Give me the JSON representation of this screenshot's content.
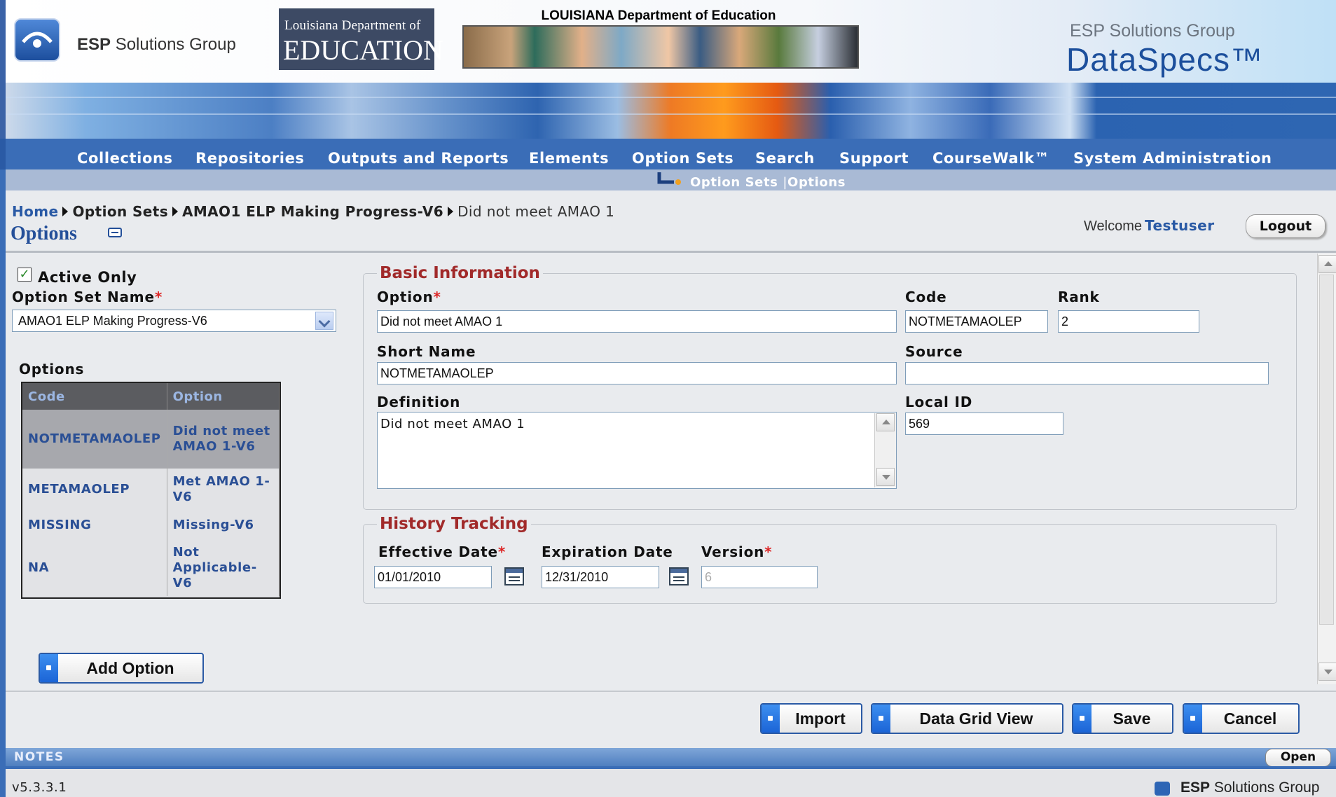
{
  "header": {
    "esp_name_bold": "ESP",
    "esp_name_rest": " Solutions Group",
    "lde_line1": "Louisiana Department of",
    "lde_line2": "EDUCATION",
    "lde_banner_title": "LOUISIANA Department of Education",
    "dataspecs_company": "ESP Solutions Group",
    "dataspecs_product": "DataSpecs™"
  },
  "nav": {
    "items": [
      "Collections",
      "Repositories",
      "Outputs and Reports",
      "Elements",
      "Option Sets",
      "Search",
      "Support",
      "CourseWalk™",
      "System Administration"
    ],
    "sub": [
      "Option Sets",
      "Options"
    ]
  },
  "breadcrumb": {
    "home": "Home",
    "option_sets": "Option Sets",
    "option_set": "AMAO1 ELP Making Progress-V6",
    "current": "Did not meet AMAO 1"
  },
  "page": {
    "title": "Options",
    "welcome": "Welcome",
    "user": "Testuser",
    "logout": "Logout"
  },
  "left": {
    "active_only": "Active Only",
    "option_set_name_label": "Option Set Name",
    "option_set_value": "AMAO1 ELP Making Progress-V6",
    "options_label": "Options",
    "table_headers": [
      "Code",
      "Option"
    ],
    "rows": [
      {
        "code": "NOTMETAMAOLEP",
        "option": "Did not meet AMAO 1-V6"
      },
      {
        "code": "METAMAOLEP",
        "option": "Met AMAO 1-V6"
      },
      {
        "code": "MISSING",
        "option": "Missing-V6"
      },
      {
        "code": "NA",
        "option": "Not Applicable-V6"
      }
    ],
    "add_option": "Add Option"
  },
  "basic": {
    "legend": "Basic Information",
    "option_label": "Option",
    "option_value": "Did not meet AMAO 1",
    "code_label": "Code",
    "code_value": "NOTMETAMAOLEP",
    "rank_label": "Rank",
    "rank_value": "2",
    "short_name_label": "Short Name",
    "short_name_value": "NOTMETAMAOLEP",
    "source_label": "Source",
    "source_value": "",
    "definition_label": "Definition",
    "definition_value": "Did not meet AMAO 1",
    "local_id_label": "Local ID",
    "local_id_value": "569"
  },
  "history": {
    "legend": "History Tracking",
    "effective_label": "Effective Date",
    "effective_value": "01/01/2010",
    "expiration_label": "Expiration Date",
    "expiration_value": "12/31/2010",
    "version_label": "Version",
    "version_value": "6"
  },
  "actions": {
    "import": "Import",
    "data_grid_view": "Data Grid View",
    "save": "Save",
    "cancel": "Cancel"
  },
  "notes": {
    "label": "NOTES",
    "open": "Open"
  },
  "footer": {
    "version": "v5.3.3.1",
    "company_bold": "ESP",
    "company_rest": " Solutions Group"
  },
  "required_marker": "*",
  "colors": {
    "nav_blue": "#3a6db7",
    "link_blue": "#2a5aa5",
    "legend_red": "#a12a2a",
    "button_accent": "#1b64d6"
  }
}
